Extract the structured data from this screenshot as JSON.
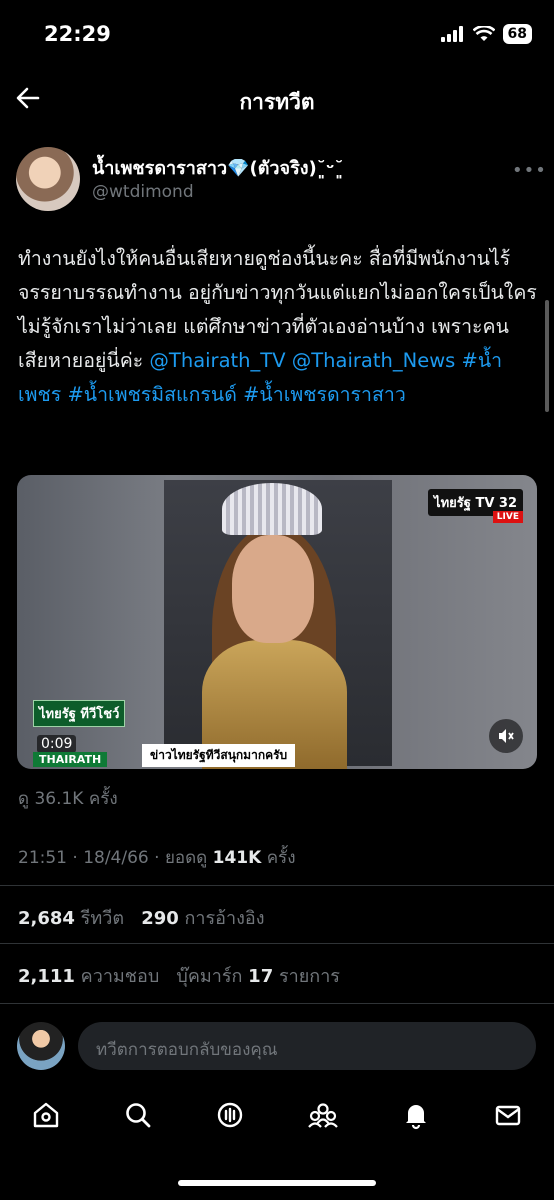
{
  "status_bar": {
    "time": "22:29",
    "battery": "68"
  },
  "header": {
    "title": "การทวีต"
  },
  "author": {
    "display_name": "น้ำเพชรดาราสาว💎(ตัวจริง)˘͈ᵕ˘͈",
    "handle": "@wtdimond"
  },
  "tweet": {
    "text_plain": "ทำงานยังไงให้คนอื่นเสียหายดูช่องนี้นะคะ สื่อที่มีพนักงานไร้จรรยาบรรณทำงาน อยู่กับข่าวทุกวันแต่แยกไม่ออกใครเป็นใคร ไม่รู้จักเราไม่ว่าเลย แต่ศึกษาข่าวที่ตัวเองอ่านบ้าง เพราะคนเสียหายอยู่นี่ค่ะ",
    "mention_1": "@Thairath_TV",
    "mention_2": "@Thairath_News",
    "hashtag_1": "#น้ำเพชร",
    "hashtag_2": "#น้ำเพชรมิสแกรนด์",
    "hashtag_3": "#น้ำเพชรดาราสาว"
  },
  "media": {
    "channel_logo": "ไทยรัฐ TV 32",
    "live_label": "LIVE",
    "show_badge": "ไทยรัฐ ทีวีโชว์",
    "duration": "0:09",
    "network_tag": "THAIRATH",
    "ticker": "ข่าวไทยรัฐทีวีสนุกมากครับ"
  },
  "stats": {
    "views": "ดู 36.1K ครั้ง",
    "date_prefix": "21:51 · 18/4/66 · ยอดดู",
    "view_count": "141K",
    "view_suffix": "ครั้ง",
    "retweets": "2,684",
    "retweets_label": "รีทวีต",
    "quotes": "290",
    "quotes_label": "การอ้างอิง",
    "likes": "2,111",
    "likes_label": "ความชอบ",
    "bookmarks_label": "บุ๊คมาร์ก",
    "bookmarks": "17",
    "bookmarks_suffix": "รายการ"
  },
  "reply": {
    "placeholder": "ทวีตการตอบกลับของคุณ"
  },
  "nav": {
    "icons": [
      "home-icon",
      "search-icon",
      "spaces-icon",
      "communities-icon",
      "notifications-icon",
      "messages-icon"
    ]
  }
}
